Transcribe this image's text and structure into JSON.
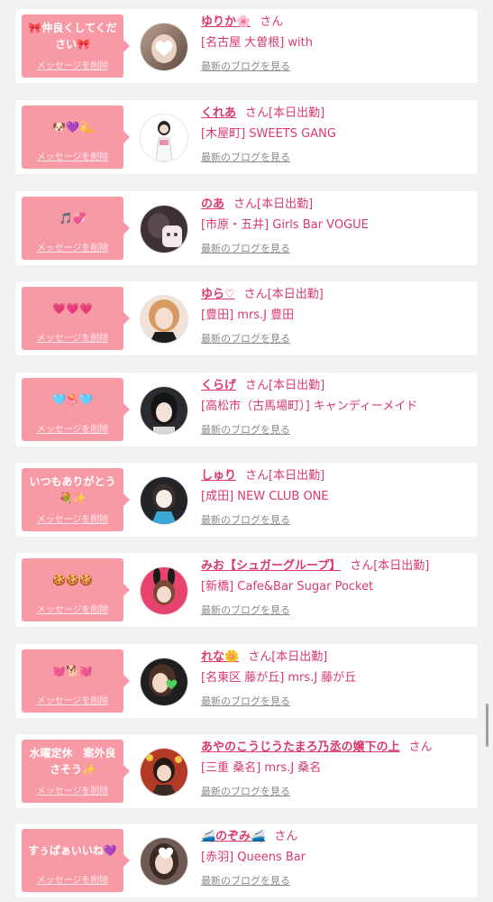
{
  "delete_label": "メッセージを削除",
  "blog_label": "最新のブログを見る",
  "colors": {
    "accent": "#d93a6a",
    "bubble": "#f89aa6",
    "card": "#ffffff",
    "background": "#f2f2f2"
  },
  "entries": [
    {
      "message": "🎀仲良くしてください🎀",
      "name": "ゆりか🌸",
      "san": "さん",
      "shop": "[名古屋 大曽根] with"
    },
    {
      "message": "🐶💜💫",
      "name": "くれあ",
      "san": "さん[本日出勤]",
      "shop": "[木屋町] SWEETS GANG"
    },
    {
      "message": "🎵💞",
      "name": "のあ",
      "san": "さん[本日出勤]",
      "shop": "[市原・五井] Girls Bar VOGUE"
    },
    {
      "message": "💗💗💗",
      "name": "ゆら♡",
      "san": "さん[本日出勤]",
      "shop": "[豊田] mrs.J 豊田"
    },
    {
      "message": "🩵🪼🩵",
      "name": "くらげ",
      "san": "さん[本日出勤]",
      "shop": "[高松市（古馬場町）] キャンディーメイド"
    },
    {
      "message": "いつもありがとう💐✨",
      "name": "しゅり",
      "san": "さん[本日出勤]",
      "shop": "[成田] NEW CLUB ONE"
    },
    {
      "message": "🍪🍪🍪",
      "name": "みお【シュガーグループ】",
      "san": "さん[本日出勤]",
      "shop": "[新橋] Cafe&Bar Sugar Pocket"
    },
    {
      "message": "💓🐕💓",
      "name": "れな🌼",
      "san": "さん[本日出勤]",
      "shop": "[名東区 藤が丘] mrs.J 藤が丘"
    },
    {
      "message": "水曜定休　案外良さそう✨",
      "name": "あやのこうじうたまろ乃丞の嬢下の上",
      "san": "さん",
      "shop": "[三重 桑名] mrs.J 桑名"
    },
    {
      "message": "すぅぱぁいいね💜",
      "name": "🚄のぞみ🚄",
      "san": "さん",
      "shop": "[赤羽] Queens Bar"
    }
  ]
}
